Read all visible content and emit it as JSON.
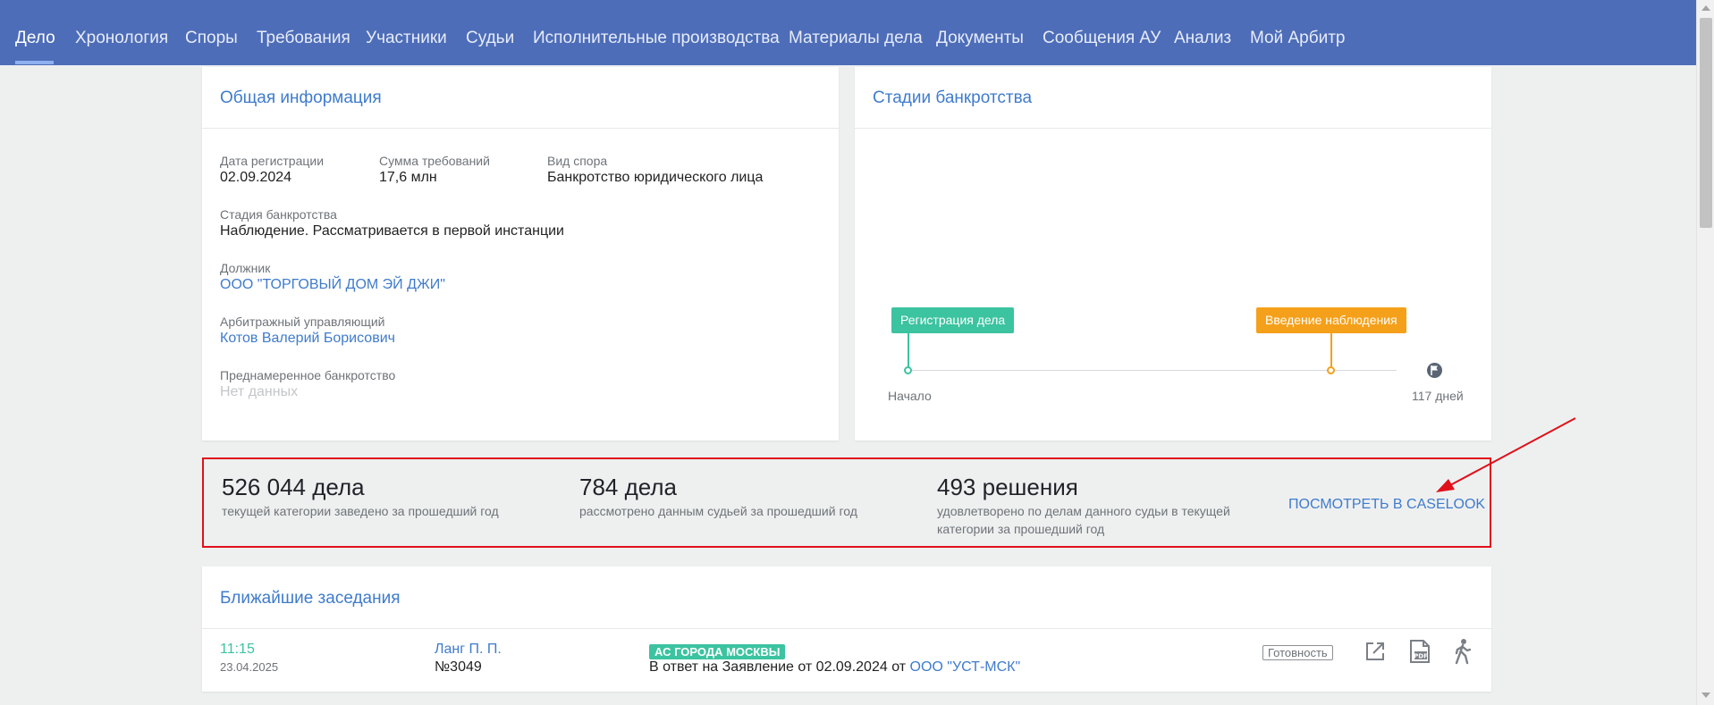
{
  "nav": {
    "tabs": [
      {
        "label": "Дело",
        "active": true
      },
      {
        "label": "Хронология"
      },
      {
        "label": "Споры"
      },
      {
        "label": "Требования"
      },
      {
        "label": "Участники"
      },
      {
        "label": "Судьи"
      },
      {
        "label": "Исполнительные производства"
      },
      {
        "label": "Материалы дела"
      },
      {
        "label": "Документы"
      },
      {
        "label": "Сообщения АУ"
      },
      {
        "label": "Анализ"
      },
      {
        "label": "Мой Арбитр"
      }
    ]
  },
  "general_info": {
    "title": "Общая информация",
    "registration_date": {
      "label": "Дата регистрации",
      "value": "02.09.2024"
    },
    "claims_sum": {
      "label": "Сумма требований",
      "value": "17,6 млн"
    },
    "dispute_type": {
      "label": "Вид спора",
      "value": "Банкротство юридического лица"
    },
    "stage": {
      "label": "Стадия банкротства",
      "value": "Наблюдение. Рассматривается в первой инстанции"
    },
    "debtor": {
      "label": "Должник",
      "value": "ООО \"ТОРГОВЫЙ ДОМ ЭЙ ДЖИ\""
    },
    "manager": {
      "label": "Арбитражный управляющий",
      "value": "Котов Валерий Борисович"
    },
    "deliberate": {
      "label": "Преднамеренное банкротство",
      "value": "Нет данных"
    }
  },
  "stages": {
    "title": "Стадии банкротства",
    "events": [
      {
        "label": "Регистрация дела",
        "color": "#3cc3a0"
      },
      {
        "label": "Введение наблюдения",
        "color": "#f5a01a"
      }
    ],
    "start_label": "Начало",
    "end_label": "117 дней"
  },
  "stats": {
    "items": [
      {
        "number": "526 044 дела",
        "desc": "текущей категории заведено за прошедший год"
      },
      {
        "number": "784 дела",
        "desc": "рассмотрено данным судьей за прошедший год"
      },
      {
        "number": "493 решения",
        "desc": "удовлетворено по делам данного судьи в текущей категории за прошедший год"
      }
    ],
    "link": "ПОСМОТРЕТЬ В CASELOOK"
  },
  "hearings": {
    "title": "Ближайшие заседания",
    "rows": [
      {
        "time": "11:15",
        "date": "23.04.2025",
        "judge": "Ланг П. П.",
        "room": "№3049",
        "court": "АС ГОРОДА МОСКВЫ",
        "text_prefix": "В ответ на Заявление от 02.09.2024 от ",
        "party": "ООО \"УСТ-МСК\"",
        "readiness": "Готовность"
      }
    ]
  },
  "colors": {
    "nav_bg": "#4d6db9",
    "accent": "#3f7bcc",
    "green": "#3cc3a0",
    "orange": "#f5a01a",
    "annotation_red": "#e0101a"
  },
  "icons": [
    "external-link-icon",
    "pdf-icon",
    "walking-person-icon",
    "flag-icon"
  ]
}
